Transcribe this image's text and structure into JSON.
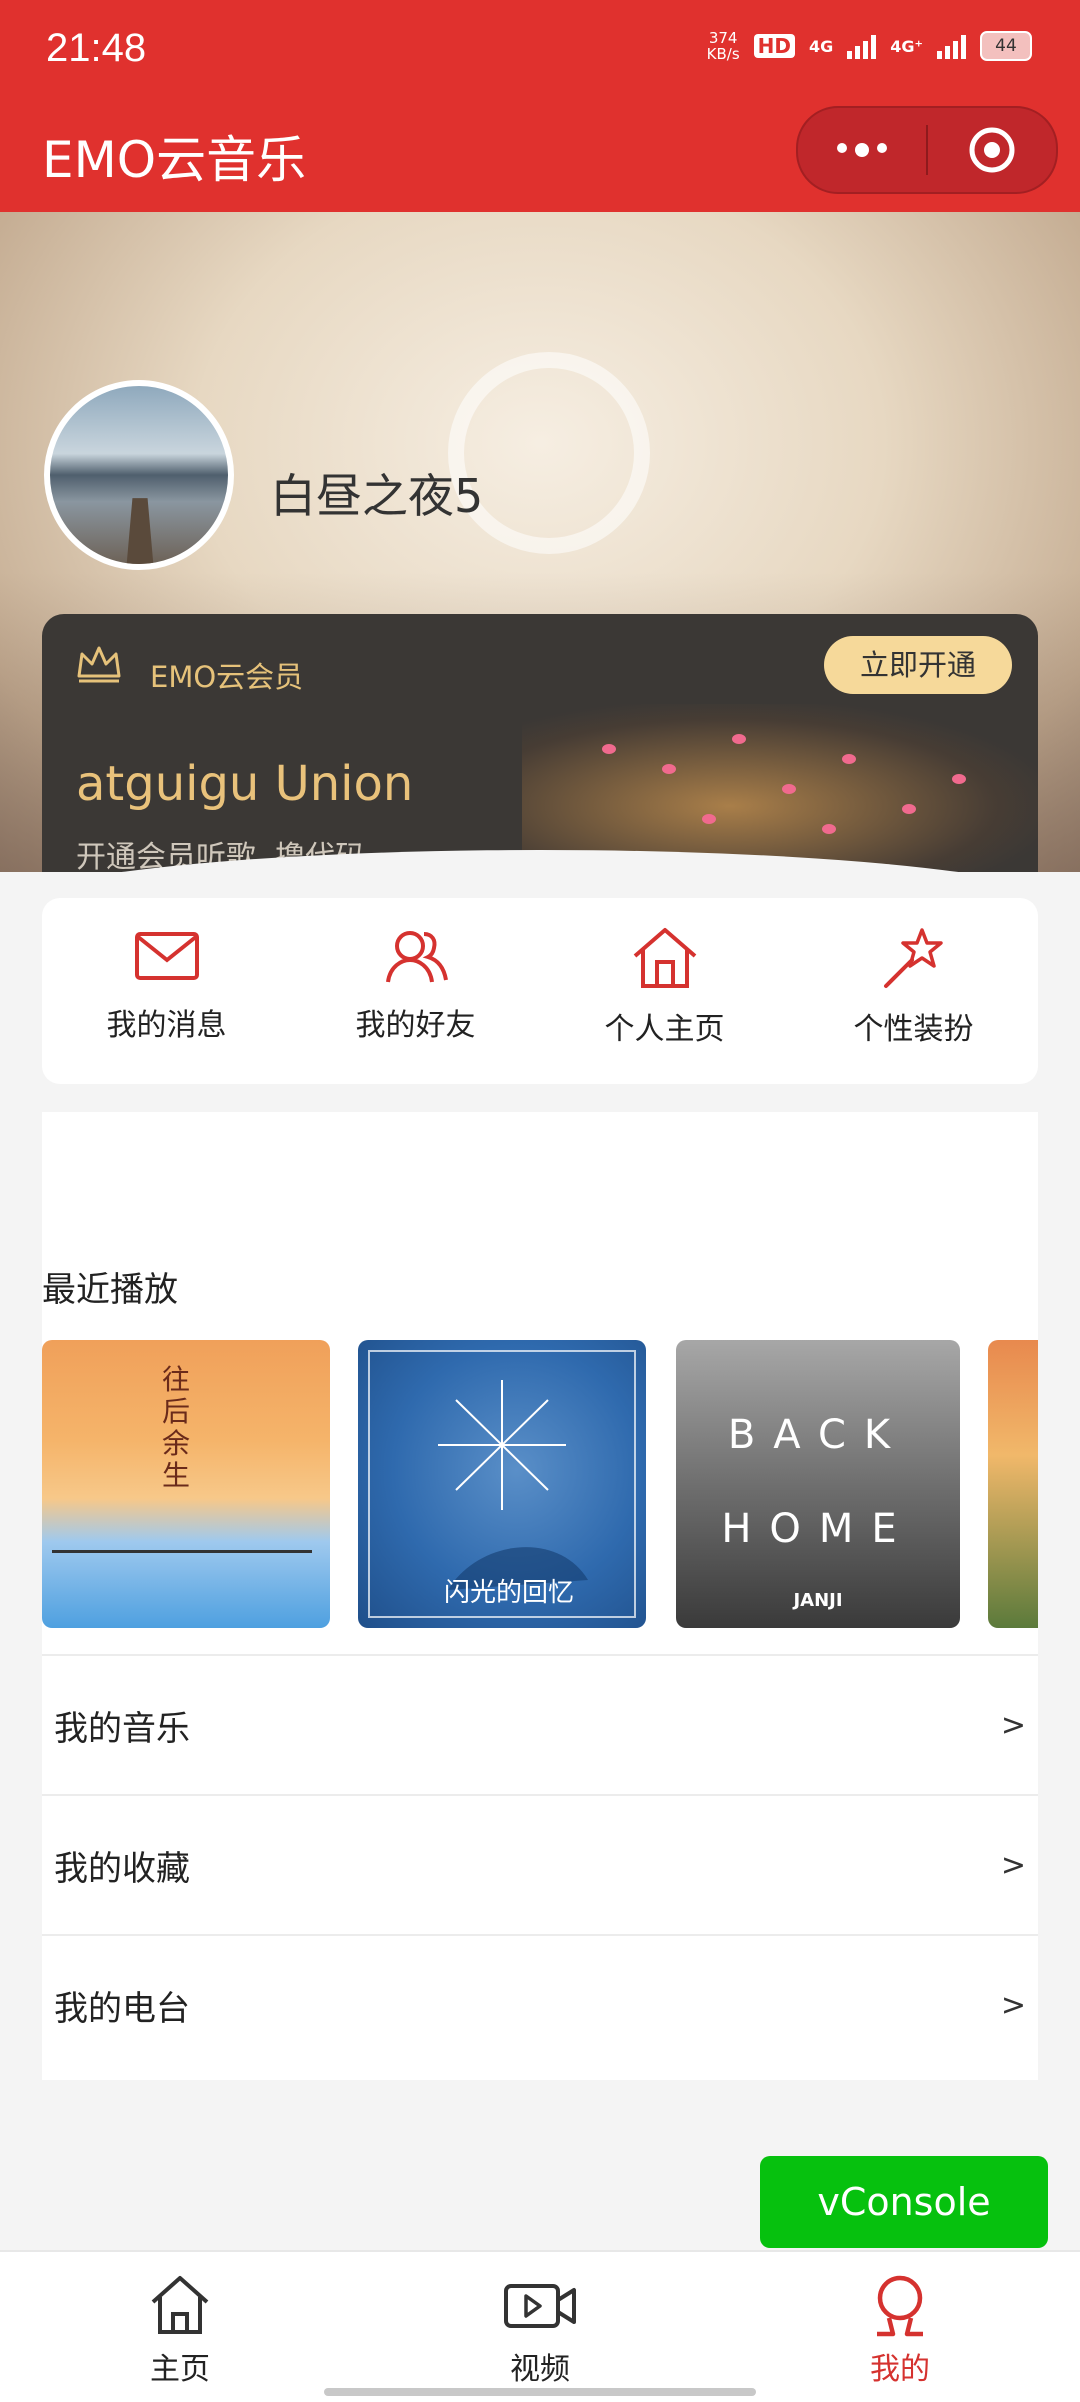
{
  "status_bar": {
    "time": "21:48",
    "net_speed_value": "374",
    "net_speed_unit": "KB/s",
    "hd_label": "HD",
    "net1": "4G",
    "net2": "4G⁺",
    "battery": "44"
  },
  "nav": {
    "title": "EMO云音乐"
  },
  "profile": {
    "username": "白昼之夜5"
  },
  "vip": {
    "label": "EMO云会员",
    "open_button": "立即开通",
    "title": "atguigu Union",
    "desc": "开通会员听歌, 撸代码"
  },
  "quick_nav": [
    {
      "label": "我的消息",
      "icon": "mail-icon"
    },
    {
      "label": "我的好友",
      "icon": "friends-icon"
    },
    {
      "label": "个人主页",
      "icon": "home-icon"
    },
    {
      "label": "个性装扮",
      "icon": "star-wand-icon"
    }
  ],
  "recent": {
    "label": "最近播放",
    "covers": [
      {
        "text": "往后余生"
      },
      {
        "text": "闪光的回忆"
      },
      {
        "line1": "BACK",
        "line2": "HOME",
        "brand": "JANJI"
      },
      {
        "text": ""
      }
    ]
  },
  "menu": [
    {
      "label": "我的音乐",
      "arrow": ">"
    },
    {
      "label": "我的收藏",
      "arrow": ">"
    },
    {
      "label": "我的电台",
      "arrow": ">"
    }
  ],
  "vconsole": "vConsole",
  "tabbar": [
    {
      "label": "主页",
      "icon": "home-icon"
    },
    {
      "label": "视频",
      "icon": "video-icon"
    },
    {
      "label": "我的",
      "icon": "profile-icon",
      "active": true
    }
  ],
  "colors": {
    "brand_red": "#e0312e",
    "vip_gold": "#e9c27b",
    "vconsole_green": "#06c10e"
  }
}
